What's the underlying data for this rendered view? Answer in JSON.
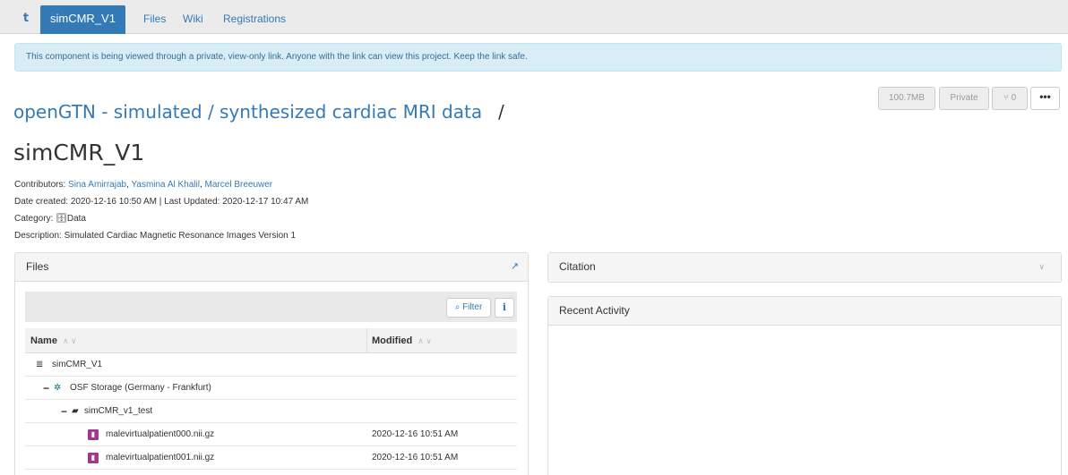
{
  "nav": {
    "home_icon": "t",
    "active": "simCMR_V1",
    "links": [
      "Files",
      "Wiki",
      "Registrations"
    ]
  },
  "alert": "This component is being viewed through a private, view-only link. Anyone with the link can view this project. Keep the link safe.",
  "actions": {
    "size": "100.7MB",
    "privacy": "Private",
    "forks": "0",
    "more": "•••"
  },
  "project": {
    "parent_title": "openGTN - simulated / synthesized cardiac MRI data",
    "slash": "/",
    "title": "simCMR_V1",
    "contributors_label": "Contributors:",
    "contributors": [
      "Sina Amirrajab",
      "Yasmina Al Khalil",
      "Marcel Breeuwer"
    ],
    "dates": "Date created: 2020-12-16 10:50 AM | Last Updated: 2020-12-17 10:47 AM",
    "category_label": "Category:",
    "category": "Data",
    "description": "Description: Simulated Cardiac Magnetic Resonance Images Version 1"
  },
  "files_panel": {
    "title": "Files",
    "filter_label": "Filter",
    "info_label": "i",
    "col_name": "Name",
    "col_modified": "Modified",
    "sort_arrows": "∧ ∨",
    "rows": [
      {
        "name": "simCMR_V1",
        "modified": ""
      },
      {
        "name": "OSF Storage (Germany - Frankfurt)",
        "modified": ""
      },
      {
        "name": "simCMR_v1_test",
        "modified": ""
      },
      {
        "name": "malevirtualpatient000.nii.gz",
        "modified": "2020-12-16 10:51 AM"
      },
      {
        "name": "malevirtualpatient001.nii.gz",
        "modified": "2020-12-16 10:51 AM"
      }
    ]
  },
  "citation_panel": {
    "title": "Citation",
    "chevron": "∨"
  },
  "activity_panel": {
    "title": "Recent Activity"
  },
  "colors": {
    "brand": "#337ab7",
    "alert_bg": "#d9edf7",
    "alert_text": "#31708f"
  }
}
